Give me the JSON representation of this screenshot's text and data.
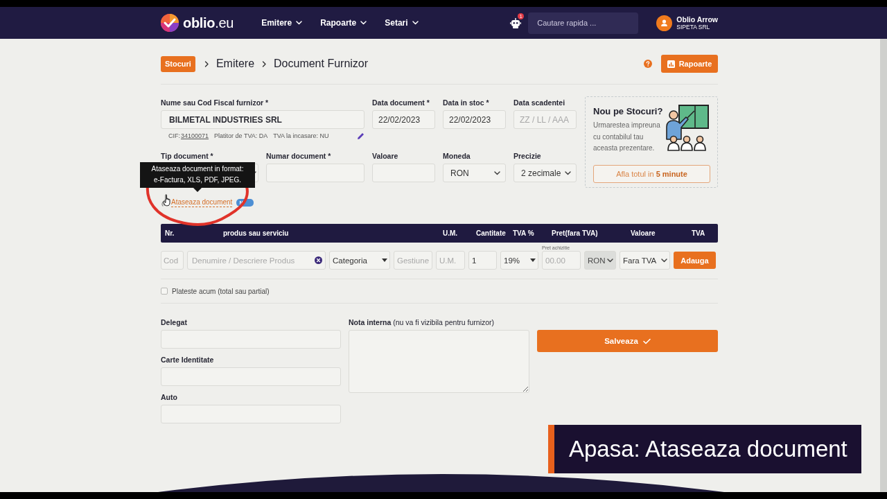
{
  "header": {
    "logo_text": "**oblio**.eu",
    "nav": [
      {
        "label": "Emitere"
      },
      {
        "label": "Rapoarte"
      },
      {
        "label": "Setari"
      }
    ],
    "notification_count": "1",
    "search": {
      "placeholder": "Cautare rapida ..."
    },
    "user": {
      "name": "Oblio Arrow",
      "company": "SIPETA SRL"
    }
  },
  "breadcrumb": [
    {
      "label": "Stocuri",
      "kind": "badge"
    },
    {
      "label": "Emitere",
      "kind": "link"
    },
    {
      "label": "Document Furnizor",
      "kind": "current"
    }
  ],
  "reports_button": "Rapoarte",
  "supplier": {
    "label": "Nume sau Cod Fiscal furnizor *",
    "value": "BILMETAL INDUSTRIES SRL",
    "cif_label": "CIF:",
    "cif": "34100071",
    "vat_payer": "Platitor de TVA: DA",
    "vat_on_collection": "TVA la incasare: NU"
  },
  "date_fields": [
    {
      "label": "Data document *",
      "value": "22/02/2023"
    },
    {
      "label": "Data in stoc *",
      "value": "22/02/2023"
    },
    {
      "label": "Data scadentei",
      "placeholder": "ZZ / LL / AAA"
    }
  ],
  "promo": {
    "title": "Nou pe Stocuri?",
    "text": "Urmarestea impreuna\ncu contabilul tau\naceasta prezentare.",
    "button": "Afla totul in **5 minute**"
  },
  "fields_row2": [
    {
      "label": "Tip document *",
      "kind": "select",
      "solid_caret": false
    },
    {
      "label": "Numar document *",
      "kind": "input"
    },
    {
      "label": "Valoare",
      "kind": "input"
    },
    {
      "label": "Moneda",
      "kind": "select",
      "value": "RON",
      "solid_caret": false
    },
    {
      "label": "Precizie",
      "kind": "select",
      "value": "2 zecimale",
      "solid_caret": false
    }
  ],
  "attach": {
    "label": "Ataseaza document",
    "badge": "N",
    "tooltip": "Ataseaza document in format: e-Factura, XLS, PDF, JPEG."
  },
  "table": {
    "columns": [
      "Nr.",
      "produs sau serviciu",
      "U.M.",
      "Cantitate",
      "TVA %",
      "Pret(fara TVA)",
      "Valoare",
      "TVA"
    ]
  },
  "entry_row": [
    {
      "kind": "input",
      "placeholder": "Cod",
      "disabled": false
    },
    {
      "kind": "clear-input",
      "placeholder": "Denumire / Descriere Produs",
      "disabled": false
    },
    {
      "kind": "select",
      "value": "Categoria",
      "solid_caret": true,
      "disabled": false
    },
    {
      "kind": "input",
      "placeholder": "Gestiune",
      "disabled": false
    },
    {
      "kind": "input",
      "placeholder": "U.M.",
      "disabled": false
    },
    {
      "kind": "input",
      "value": "1",
      "disabled": false
    },
    {
      "kind": "select",
      "value": "19%",
      "solid_caret": true,
      "disabled": false
    },
    {
      "kind": "input",
      "caption": "Pret achizitie",
      "placeholder": "00.00",
      "disabled": false
    },
    {
      "kind": "select",
      "value": "RON",
      "solid_caret": false,
      "disabled": true
    },
    {
      "kind": "select",
      "value": "Fara TVA",
      "solid_caret": false,
      "disabled": false
    },
    {
      "kind": "button",
      "label": "Adauga",
      "disabled": false
    }
  ],
  "pay_now": {
    "label": "Plateste acum (total sau partial)",
    "checked": false
  },
  "bottom": {
    "left_fields": [
      {
        "label": "Delegat"
      },
      {
        "label": "Carte Identitate"
      },
      {
        "label": "Auto"
      }
    ],
    "note_label": "**Nota interna** (nu va fi vizibila pentru furnizor)",
    "save_button": "Salveaza"
  },
  "caption": "Apasa: Ataseaza document"
}
